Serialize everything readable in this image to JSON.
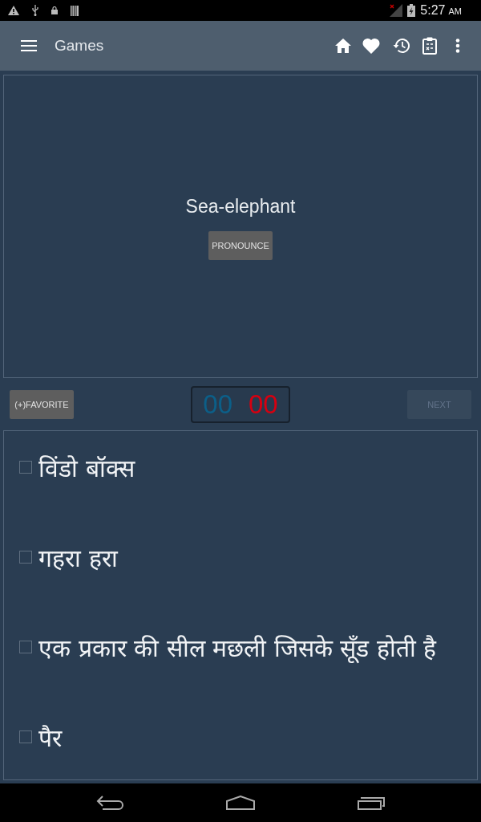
{
  "status_bar": {
    "time": "5:27",
    "time_suffix": "AM"
  },
  "app_bar": {
    "title": "Games"
  },
  "word_card": {
    "word": "Sea-elephant",
    "pronounce_button": "PRONOUNCE"
  },
  "controls": {
    "favorite_button": "(+)FAVORITE",
    "score": {
      "correct_count": "00",
      "wrong_count": "00"
    },
    "next_button": {
      "label": "NEXT",
      "disabled": true
    }
  },
  "options": [
    {
      "text": "विंडो बॉक्स",
      "checked": false
    },
    {
      "text": "गहरा हरा",
      "checked": false
    },
    {
      "text": "एक प्रकार की सील मछली जिसके सूँड होती है",
      "checked": false
    },
    {
      "text": "पैर",
      "checked": false
    }
  ]
}
